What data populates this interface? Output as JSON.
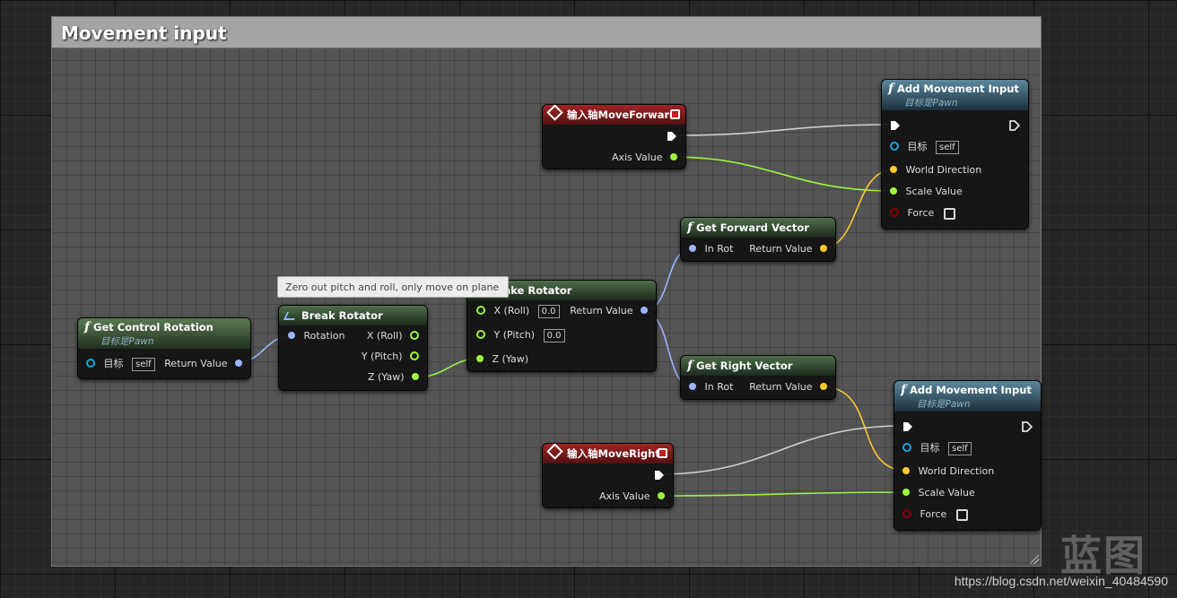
{
  "comment": {
    "title": "Movement input"
  },
  "tooltip": "Zero out pitch and roll, only move on plane",
  "watermark": {
    "logo": "蓝图",
    "url": "https://blog.csdn.net/weixin_40484590"
  },
  "colors": {
    "exec": "#ffffff",
    "object": "#1aa6dd",
    "rotator": "#9cb3ff",
    "float": "#9bf542",
    "vector": "#fdc830",
    "bool": "#8b0000"
  },
  "nodes": {
    "get_control_rotation": {
      "title": "Get Control Rotation",
      "subtitle": "目标是Pawn",
      "target_label": "目标",
      "target_value": "self",
      "return_label": "Return Value"
    },
    "break_rotator": {
      "title": "Break Rotator",
      "rotation_label": "Rotation",
      "x_label": "X (Roll)",
      "y_label": "Y (Pitch)",
      "z_label": "Z (Yaw)"
    },
    "make_rotator": {
      "title": "Make Rotator",
      "x_label": "X (Roll)",
      "x_value": "0.0",
      "y_label": "Y (Pitch)",
      "y_value": "0.0",
      "z_label": "Z (Yaw)",
      "return_label": "Return Value"
    },
    "input_move_forward": {
      "title": "输入轴MoveForward",
      "axis_label": "Axis Value"
    },
    "input_move_right": {
      "title": "输入轴MoveRight",
      "axis_label": "Axis Value"
    },
    "get_forward_vector": {
      "title": "Get Forward Vector",
      "in_label": "In Rot",
      "return_label": "Return Value"
    },
    "get_right_vector": {
      "title": "Get Right Vector",
      "in_label": "In Rot",
      "return_label": "Return Value"
    },
    "add_movement_input_1": {
      "title": "Add Movement Input",
      "subtitle": "目标是Pawn",
      "target_label": "目标",
      "target_value": "self",
      "direction_label": "World Direction",
      "scale_label": "Scale Value",
      "force_label": "Force"
    },
    "add_movement_input_2": {
      "title": "Add Movement Input",
      "subtitle": "目标是Pawn",
      "target_label": "目标",
      "target_value": "self",
      "direction_label": "World Direction",
      "scale_label": "Scale Value",
      "force_label": "Force"
    }
  }
}
